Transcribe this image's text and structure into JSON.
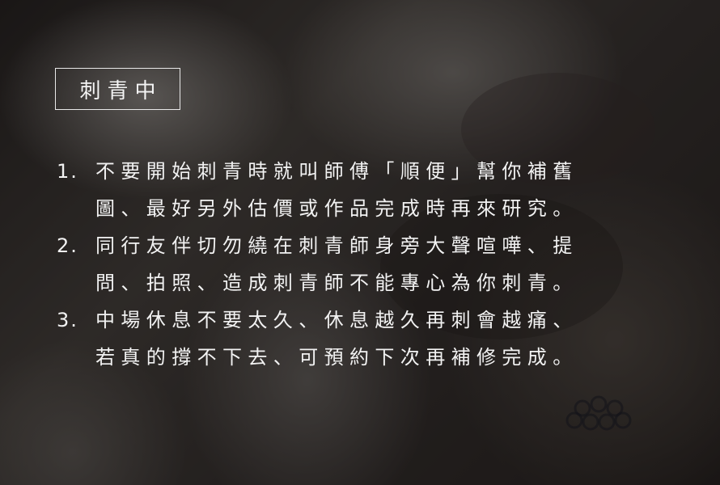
{
  "tag": "刺青中",
  "items": [
    {
      "number": "1.",
      "lines": [
        "不要開始刺青時就叫師傅「順便」幫你補舊",
        "圖、最好另外估價或作品完成時再來研究。"
      ]
    },
    {
      "number": "2.",
      "lines": [
        "同行友伴切勿繞在刺青師身旁大聲喧嘩、提",
        "問、拍照、造成刺青師不能專心為你刺青。"
      ]
    },
    {
      "number": "3.",
      "lines": [
        "中場休息不要太久、休息越久再刺會越痛、",
        "若真的撐不下去、可預約下次再補修完成。"
      ]
    }
  ]
}
